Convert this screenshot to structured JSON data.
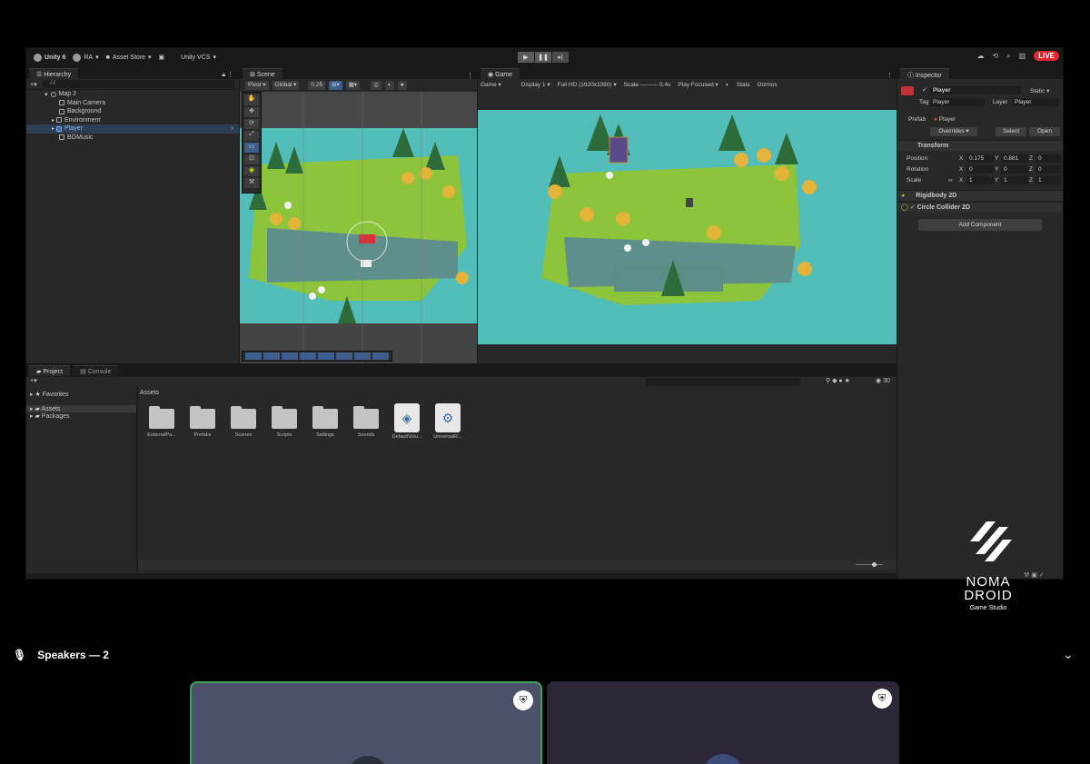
{
  "toolbar": {
    "product": "Unity 6",
    "account": "RA",
    "asset_store": "Asset Store",
    "vcs": "Unity VCS",
    "live_badge": "LIVE"
  },
  "hierarchy": {
    "tab": "Hierarchy",
    "search_placeholder": "All",
    "scene_name": "Map 2",
    "items": [
      "Main Camera",
      "Background",
      "Environment",
      "Player",
      "BGMusic"
    ],
    "selected": "Player"
  },
  "scene": {
    "tab": "Scene",
    "pivot": "Pivot",
    "space": "Global",
    "snap": "0.25"
  },
  "game": {
    "tab": "Game",
    "mode": "Game",
    "display": "Display 1",
    "resolution": "Full HD (1920x1080)",
    "scale_label": "Scale",
    "scale_value": "0.4x",
    "play_mode": "Play Focused",
    "stats": "Stats",
    "gizmos": "Gizmos"
  },
  "inspector": {
    "tab": "Inspector",
    "object_name": "Player",
    "static_label": "Static",
    "tag_label": "Tag",
    "tag_value": "Player",
    "layer_label": "Layer",
    "layer_value": "Player",
    "prefab_label": "Prefab",
    "prefab_value": "Player",
    "overrides": "Overrides",
    "select": "Select",
    "open": "Open",
    "transform": {
      "title": "Transform",
      "position_label": "Position",
      "rotation_label": "Rotation",
      "scale_label": "Scale",
      "position": {
        "x": "0.175",
        "y": "0.881",
        "z": "0"
      },
      "rotation": {
        "x": "0",
        "y": "0",
        "z": "0"
      },
      "scale": {
        "x": "1",
        "y": "1",
        "z": "1"
      }
    },
    "components": [
      "Rigidbody 2D",
      "Circle Collider 2D"
    ],
    "add_component": "Add Component"
  },
  "project": {
    "tab_project": "Project",
    "tab_console": "Console",
    "favorites": "Favorites",
    "assets_root": "Assets",
    "packages": "Packages",
    "breadcrumb": "Assets",
    "asset_count": "30",
    "assets": [
      "ExternalPa...",
      "Prefabs",
      "Scenes",
      "Scripts",
      "Settings",
      "Sounds",
      "DefaultVolu...",
      "UniversalR..."
    ]
  },
  "speakers": {
    "label": "Speakers — 2"
  },
  "logo": {
    "line1": "NOMA",
    "line2": "DROID",
    "tagline": "Game Studio"
  },
  "colors": {
    "water": "#52bdb9",
    "grass": "#8cc43c",
    "live_red": "#e0262f",
    "speaker_active_border": "#3ba55d"
  }
}
